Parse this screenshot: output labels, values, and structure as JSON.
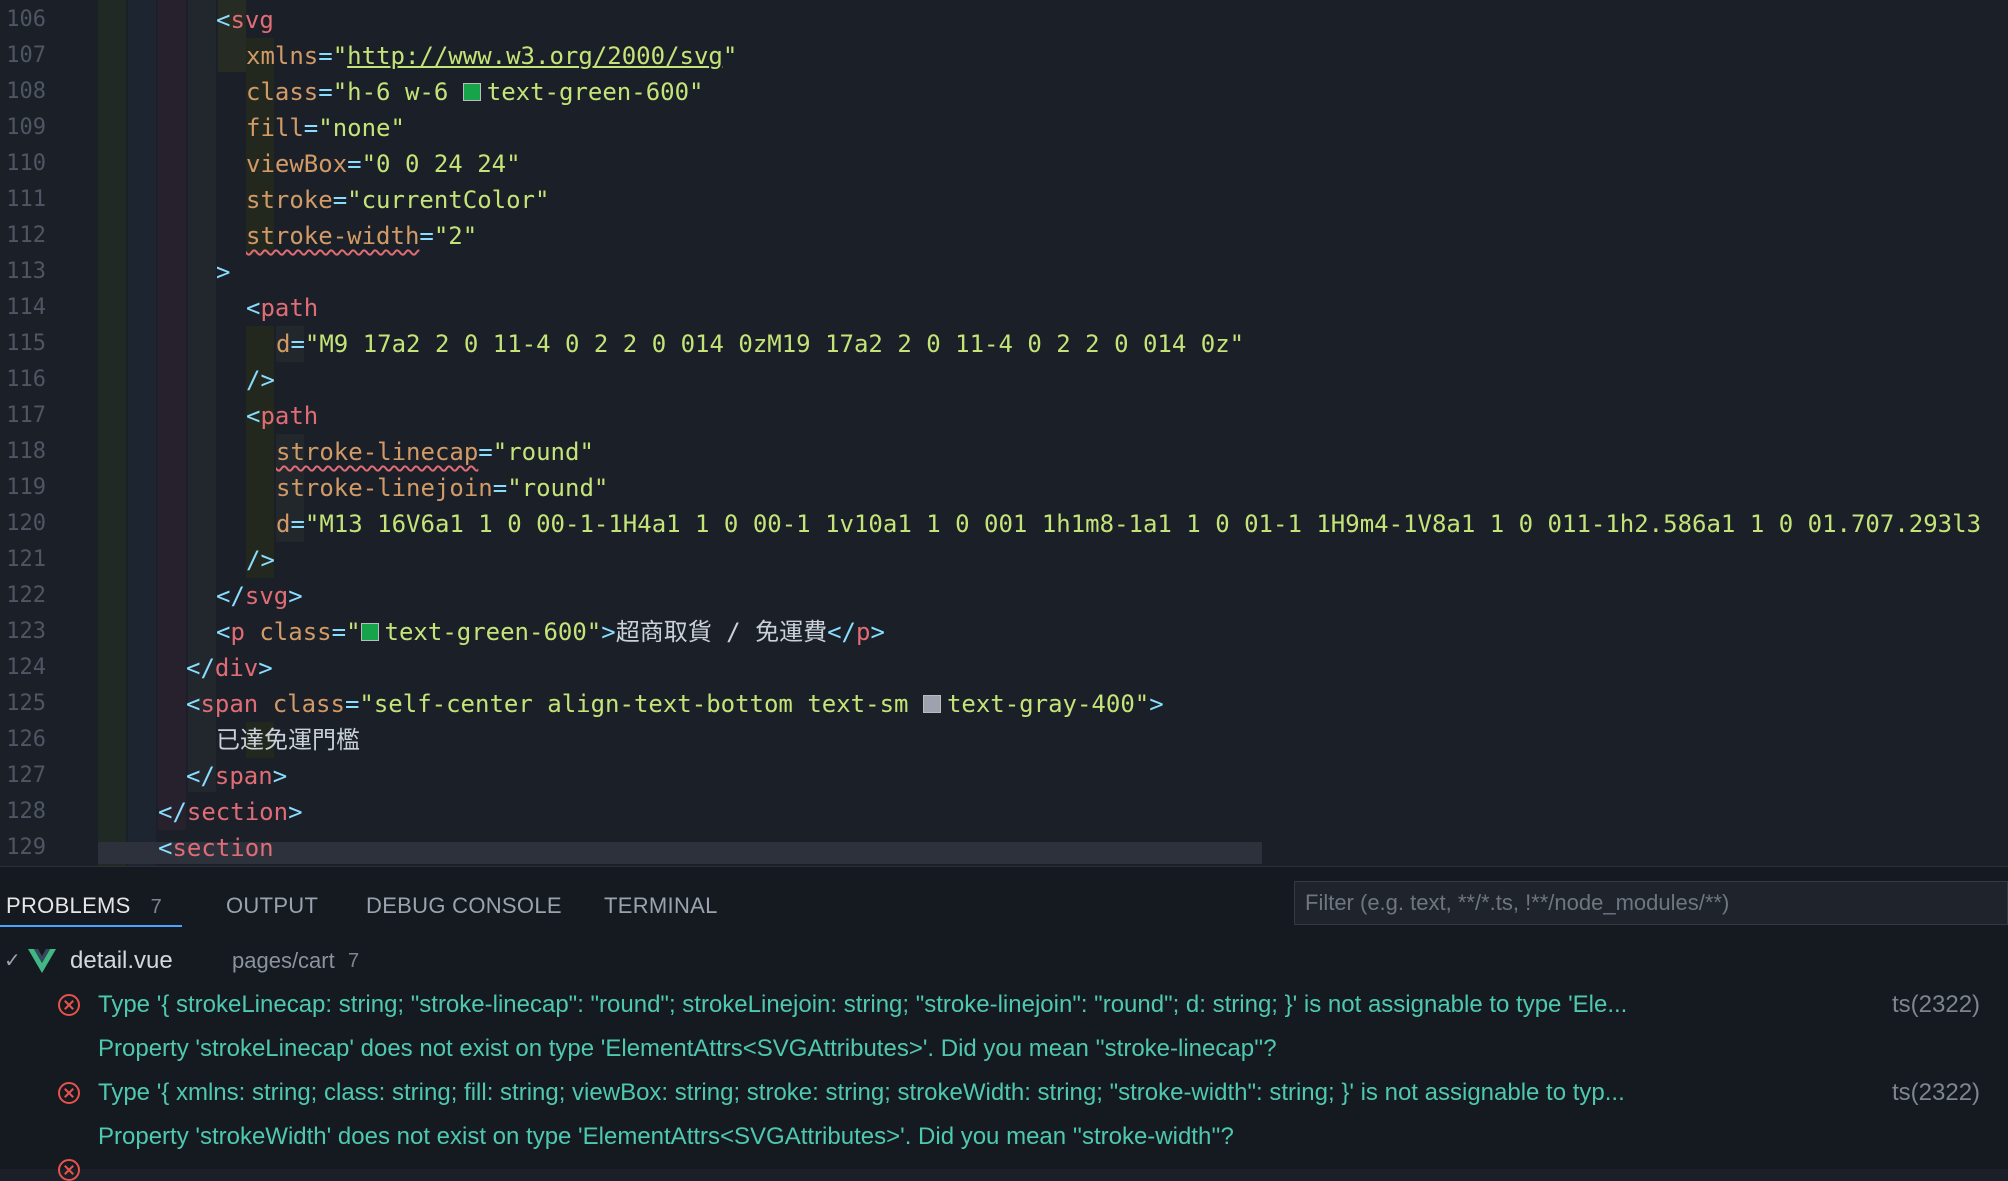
{
  "editor": {
    "line_numbers": [
      "106",
      "107",
      "108",
      "109",
      "110",
      "111",
      "112",
      "113",
      "114",
      "115",
      "116",
      "117",
      "118",
      "119",
      "120",
      "121",
      "122",
      "123",
      "124",
      "125",
      "126",
      "127",
      "128",
      "129"
    ],
    "lines": {
      "l106": {
        "open": "<",
        "tag": "svg"
      },
      "l107": {
        "attr": "xmlns",
        "eq": "=",
        "q1": "\"",
        "val": "http://www.w3.org/2000/svg",
        "q2": "\""
      },
      "l108": {
        "attr": "class",
        "eq": "=",
        "val_a": "\"h-6 w-6 ",
        "val_b": "text-green-600\"",
        "swatch": "#16a34a"
      },
      "l109": {
        "attr": "fill",
        "eq": "=",
        "val": "\"none\""
      },
      "l110": {
        "attr": "viewBox",
        "eq": "=",
        "val": "\"0 0 24 24\""
      },
      "l111": {
        "attr": "stroke",
        "eq": "=",
        "val": "\"currentColor\""
      },
      "l112": {
        "attr": "stroke-width",
        "eq": "=",
        "val": "\"2\""
      },
      "l113": {
        "close": ">"
      },
      "l114": {
        "open": "<",
        "tag": "path"
      },
      "l115": {
        "attr": "d",
        "eq": "=",
        "val": "\"M9 17a2 2 0 11-4 0 2 2 0 014 0zM19 17a2 2 0 11-4 0 2 2 0 014 0z\""
      },
      "l116": {
        "close": "/>"
      },
      "l117": {
        "open": "<",
        "tag": "path"
      },
      "l118": {
        "attr": "stroke-linecap",
        "eq": "=",
        "val": "\"round\""
      },
      "l119": {
        "attr": "stroke-linejoin",
        "eq": "=",
        "val": "\"round\""
      },
      "l120": {
        "attr": "d",
        "eq": "=",
        "val": "\"M13 16V6a1 1 0 00-1-1H4a1 1 0 00-1 1v10a1 1 0 001 1h1m8-1a1 1 0 01-1 1H9m4-1V8a1 1 0 011-1h2.586a1 1 0 01.707.293l3"
      },
      "l121": {
        "close": "/>"
      },
      "l122": {
        "open": "</",
        "tag": "svg",
        "close": ">"
      },
      "l123": {
        "open": "<",
        "tag": "p",
        "attr": "class",
        "eq": "=",
        "q1": "\"",
        "val": "text-green-600\"",
        "close": ">",
        "text": "超商取貨 / 免運費",
        "end_open": "</",
        "end_tag": "p",
        "end_close": ">",
        "swatch": "#16a34a"
      },
      "l124": {
        "open": "</",
        "tag": "div",
        "close": ">"
      },
      "l125": {
        "open": "<",
        "tag": "span",
        "attr": "class",
        "eq": "=",
        "val_a": "\"self-center align-text-bottom text-sm ",
        "val_b": "text-gray-400\"",
        "close": ">",
        "swatch": "#9ca3af"
      },
      "l126": {
        "text": "已達免運門檻"
      },
      "l127": {
        "open": "</",
        "tag": "span",
        "close": ">"
      },
      "l128": {
        "open": "</",
        "tag": "section",
        "close": ">"
      },
      "l129": {
        "open": "<",
        "tag": "section"
      }
    }
  },
  "panel": {
    "tabs": [
      {
        "label": "PROBLEMS",
        "count": "7"
      },
      {
        "label": "OUTPUT"
      },
      {
        "label": "DEBUG CONSOLE"
      },
      {
        "label": "TERMINAL"
      }
    ],
    "filter_placeholder": "Filter (e.g. text, **/*.ts, !**/node_modules/**)",
    "file": {
      "name": "detail.vue",
      "path": "pages/cart",
      "count": "7"
    },
    "problems": [
      {
        "message": "Type '{ strokeLinecap: string; \"stroke-linecap\": \"round\"; strokeLinejoin: string; \"stroke-linejoin\": \"round\"; d: string; }' is not assignable to type 'Ele...",
        "code": "ts(2322)",
        "detail": "Property 'strokeLinecap' does not exist on type 'ElementAttrs<SVGAttributes>'. Did you mean ''stroke-linecap''?"
      },
      {
        "message": "Type '{ xmlns: string; class: string; fill: string; viewBox: string; stroke: string; strokeWidth: string; \"stroke-width\": string; }' is not assignable to typ...",
        "code": "ts(2322)",
        "detail": "Property 'strokeWidth' does not exist on type 'ElementAttrs<SVGAttributes>'. Did you mean ''stroke-width''?"
      }
    ]
  },
  "colors": {
    "error": "#e5534b",
    "accent": "#4aa3ff",
    "vue_green": "#41b883"
  }
}
